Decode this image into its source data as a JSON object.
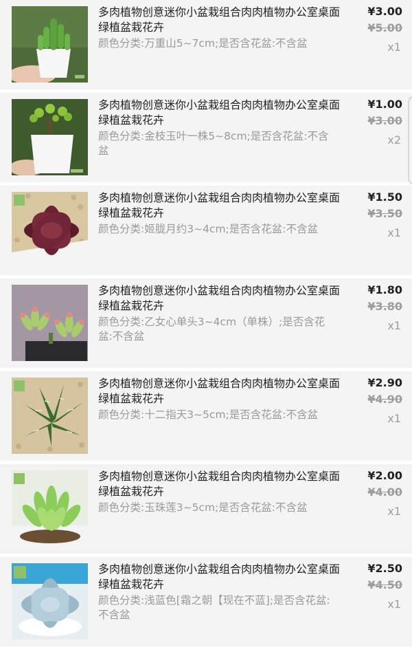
{
  "items": [
    {
      "title": "多肉植物创意迷你小盆栽组合肉肉植物办公室桌面绿植盆栽花卉",
      "spec": "颜色分类:万重山5~7cm;是否含花盆:不含盆",
      "price": "¥3.00",
      "original_price": "¥5.00",
      "quantity": "x1"
    },
    {
      "title": "多肉植物创意迷你小盆栽组合肉肉植物办公室桌面绿植盆栽花卉",
      "spec": "颜色分类:金枝玉叶一株5~8cm;是否含花盆:不含盆",
      "price": "¥1.00",
      "original_price": "¥3.00",
      "quantity": "x2"
    },
    {
      "title": "多肉植物创意迷你小盆栽组合肉肉植物办公室桌面绿植盆栽花卉",
      "spec": "颜色分类:姬胧月约3~4cm;是否含花盆:不含盆",
      "price": "¥1.50",
      "original_price": "¥3.50",
      "quantity": "x1"
    },
    {
      "title": "多肉植物创意迷你小盆栽组合肉肉植物办公室桌面绿植盆栽花卉",
      "spec": "颜色分类:乙女心单头3~4cm（单株）;是否含花盆:不含盆",
      "price": "¥1.80",
      "original_price": "¥3.80",
      "quantity": "x1"
    },
    {
      "title": "多肉植物创意迷你小盆栽组合肉肉植物办公室桌面绿植盆栽花卉",
      "spec": "颜色分类:十二指天3~5cm;是否含花盆:不含盆",
      "price": "¥2.90",
      "original_price": "¥4.90",
      "quantity": "x1"
    },
    {
      "title": "多肉植物创意迷你小盆栽组合肉肉植物办公室桌面绿植盆栽花卉",
      "spec": "颜色分类:玉珠莲3~5cm;是否含花盆:不含盆",
      "price": "¥2.00",
      "original_price": "¥4.00",
      "quantity": "x1"
    },
    {
      "title": "多肉植物创意迷你小盆栽组合肉肉植物办公室桌面绿植盆栽花卉",
      "spec": "颜色分类:浅蓝色[霜之朝【现在不蓝];是否含花盆:不含盆",
      "price": "¥2.50",
      "original_price": "¥4.50",
      "quantity": "x1"
    }
  ],
  "thumbnails": [
    "cactus-plant-image",
    "jade-plant-image",
    "dark-red-rosette-image",
    "pink-tip-succulent-image",
    "zebra-haworthia-image",
    "green-echeveria-image",
    "blue-rosette-image"
  ],
  "colors": {
    "row_background": "#f4f4f4",
    "title_text": "#222222",
    "secondary_text": "#9a9a9a"
  }
}
